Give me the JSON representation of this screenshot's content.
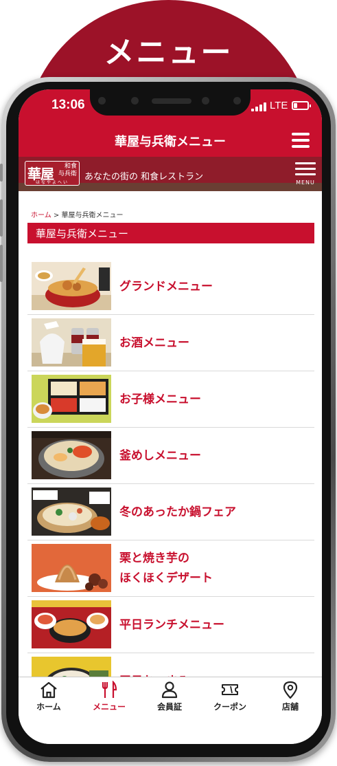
{
  "banner": {
    "title": "メニュー"
  },
  "status_bar": {
    "time": "13:06",
    "network": "LTE"
  },
  "app_bar": {
    "title": "華屋与兵衛メニュー"
  },
  "brand_bar": {
    "logo_main": "華屋",
    "logo_sub_1": "和食",
    "logo_sub_2": "与兵衛",
    "logo_kana": "はなやよへい",
    "tagline": "あなたの街の 和食レストラン",
    "menu_label": "MENU"
  },
  "breadcrumb": {
    "home": "ホーム",
    "separator": " > ",
    "current": "華屋与兵衛メニュー"
  },
  "section": {
    "title": "華屋与兵衛メニュー"
  },
  "menu_items": [
    {
      "label": "グランドメニュー"
    },
    {
      "label": "お酒メニュー"
    },
    {
      "label": "お子様メニュー"
    },
    {
      "label": "釜めしメニュー"
    },
    {
      "label": "冬のあったか鍋フェア"
    },
    {
      "label_line1": "栗と焼き芋の",
      "label_line2": "ほくほくデザート"
    },
    {
      "label": "平日ランチメニュー"
    },
    {
      "label": "平日おつまみ"
    }
  ],
  "bottom_nav": [
    {
      "label": "ホーム",
      "icon": "home-icon"
    },
    {
      "label": "メニュー",
      "icon": "fork-knife-icon",
      "active": true
    },
    {
      "label": "会員証",
      "icon": "person-icon"
    },
    {
      "label": "クーポン",
      "icon": "ticket-icon"
    },
    {
      "label": "店舗",
      "icon": "location-pin-icon"
    }
  ],
  "colors": {
    "brand_red": "#c8102e",
    "dome_maroon": "#9c1228",
    "brand_bar": "#8f1c2a"
  }
}
